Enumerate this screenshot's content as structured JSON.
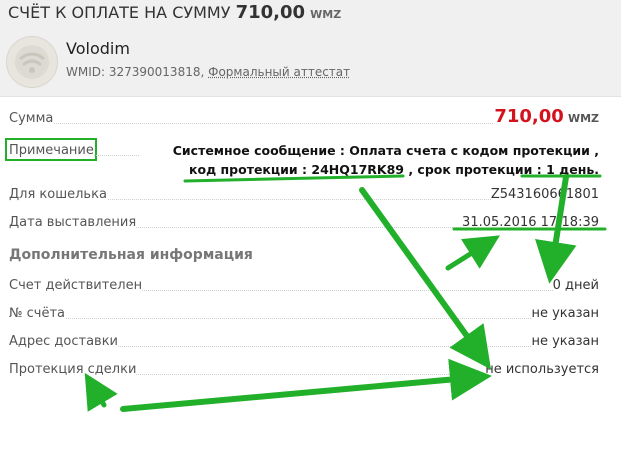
{
  "header": {
    "title_prefix": "СЧЁТ К ОПЛАТЕ НА СУММУ",
    "amount": "710,00",
    "currency": "WMZ",
    "user_name": "Volodim",
    "wmid_label": "WMID: 327390013818,",
    "attestat": "Формальный аттестат"
  },
  "rows": {
    "amount_label": "Сумма",
    "amount_value": "710,00",
    "amount_currency": "WMZ",
    "note_label": "Примечание",
    "note_line1": "Системное сообщение : Оплата счета с кодом протекции ,",
    "note_line2": "код протекции : 24HQ17RK89 , срок протекции : 1 день.",
    "wallet_label": "Для кошелька",
    "wallet_value": "Z543160661801",
    "date_label": "Дата выставления",
    "date_value": "31.05.2016 17:18:39"
  },
  "additional": {
    "title": "Дополнительная информация",
    "valid_label": "Счет действителен",
    "valid_value": "0 дней",
    "number_label": "№ счёта",
    "number_value": "не указан",
    "delivery_label": "Адрес доставки",
    "delivery_value": "не указан",
    "protection_label": "Протекция сделки",
    "protection_value": "не используется"
  },
  "colors": {
    "accent_red": "#d3121d",
    "annotation_green": "#22b02a"
  },
  "icons": {
    "avatar": "user-avatar-icon"
  }
}
